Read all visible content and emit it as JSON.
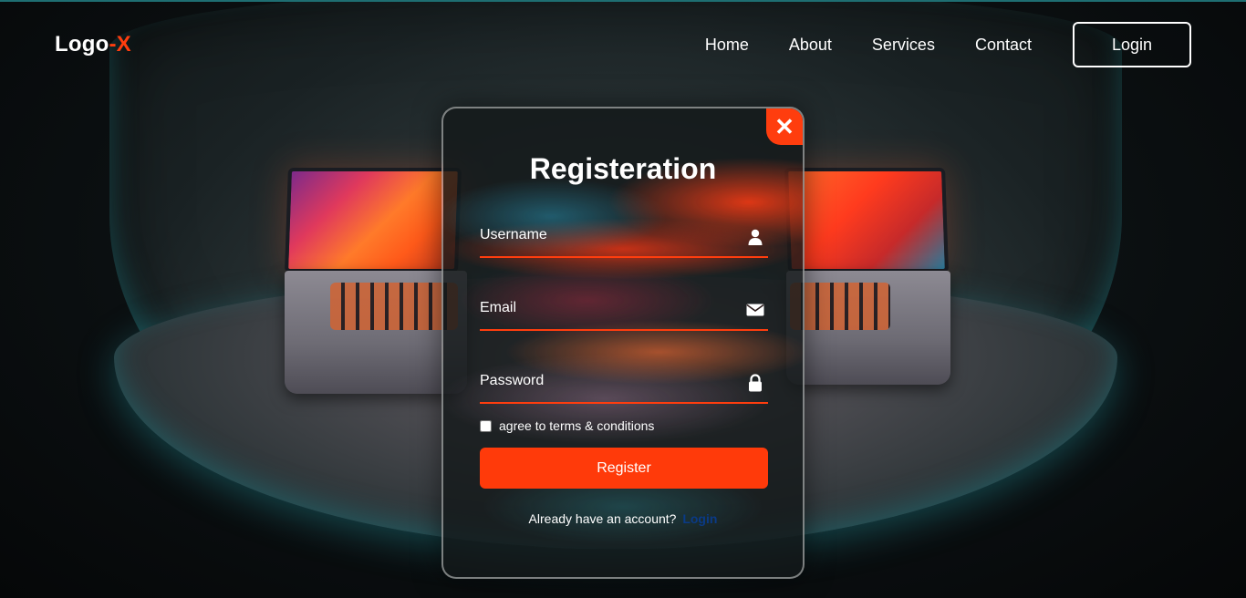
{
  "header": {
    "logo_text": "Logo",
    "logo_accent": "-X",
    "nav": [
      {
        "label": "Home"
      },
      {
        "label": "About"
      },
      {
        "label": "Services"
      },
      {
        "label": "Contact"
      }
    ],
    "login_label": "Login"
  },
  "modal": {
    "title": "Registeration",
    "close_icon": "close-icon",
    "username": {
      "placeholder": "Username",
      "icon": "user-icon"
    },
    "email": {
      "placeholder": "Email",
      "icon": "envelope-icon"
    },
    "password": {
      "placeholder": "Password",
      "icon": "lock-icon"
    },
    "terms_label": "agree to terms & conditions",
    "terms_checked": false,
    "register_label": "Register",
    "already_text": "Already have an account?",
    "login_link": "Login"
  },
  "colors": {
    "accent": "#ff3d0e",
    "button": "#ff3a0a",
    "link": "#0a3a86",
    "text": "#ffffff"
  }
}
